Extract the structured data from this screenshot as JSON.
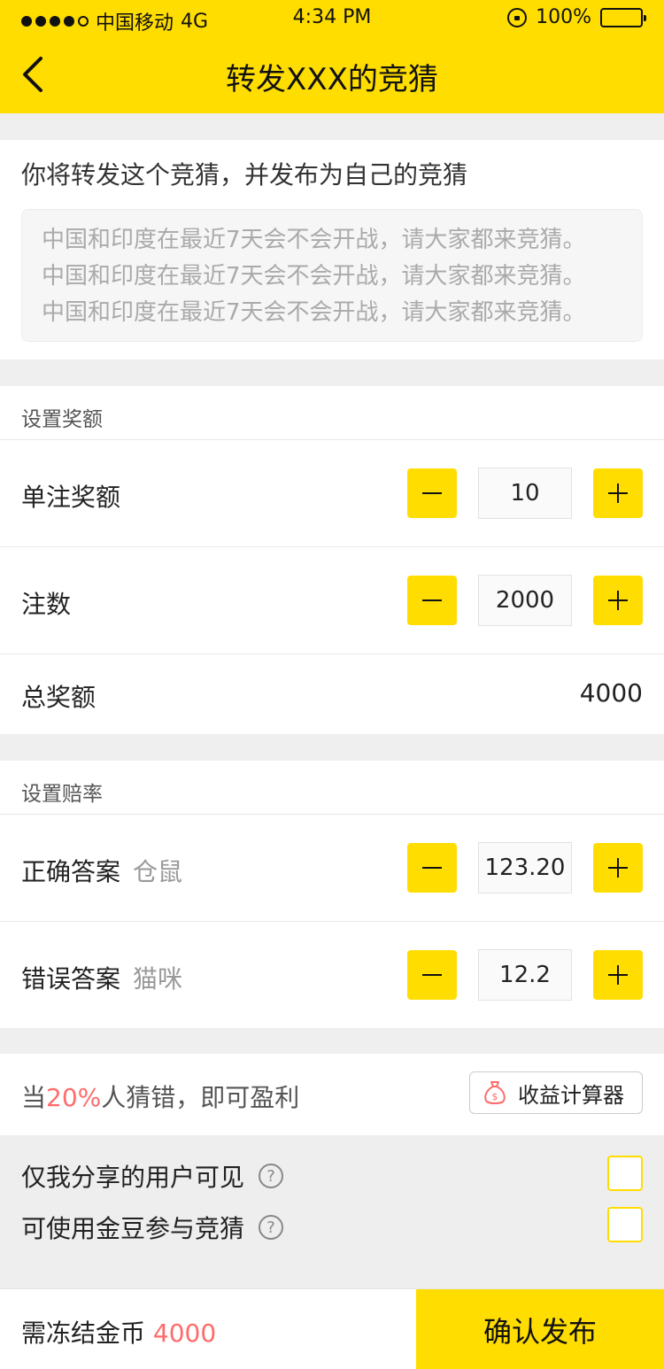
{
  "status_bar": {
    "carrier": "中国移动",
    "network": "4G",
    "time": "4:34 PM",
    "battery": "100%"
  },
  "navbar": {
    "title": "转发XXX的竞猜"
  },
  "intro": {
    "headline": "你将转发这个竞猜，并发布为自己的竞猜",
    "quote_lines": [
      "中国和印度在最近7天会不会开战，请大家都来竞猜。",
      "中国和印度在最近7天会不会开战，请大家都来竞猜。",
      "中国和印度在最近7天会不会开战，请大家都来竞猜。"
    ]
  },
  "reward": {
    "section_title": "设置奖额",
    "single_label": "单注奖额",
    "single_value": "10",
    "count_label": "注数",
    "count_value": "2000",
    "total_label": "总奖额",
    "total_value": "4000"
  },
  "odds": {
    "section_title": "设置赔率",
    "correct_label": "正确答案",
    "correct_answer": "仓鼠",
    "correct_value": "123.20",
    "wrong_label": "错误答案",
    "wrong_answer": "猫咪",
    "wrong_value": "12.2"
  },
  "profit": {
    "prefix": "当",
    "percent": "20%",
    "suffix": "人猜错，即可盈利",
    "calculator_label": "收益计算器"
  },
  "options": {
    "share_only_label": "仅我分享的用户可见",
    "gold_bean_label": "可使用金豆参与竞猜",
    "help_symbol": "?"
  },
  "footer": {
    "freeze_label": "需冻结金币",
    "freeze_amount": "4000",
    "confirm_label": "确认发布"
  },
  "colors": {
    "accent": "#ffdd00",
    "highlight": "#ff6b6b"
  }
}
